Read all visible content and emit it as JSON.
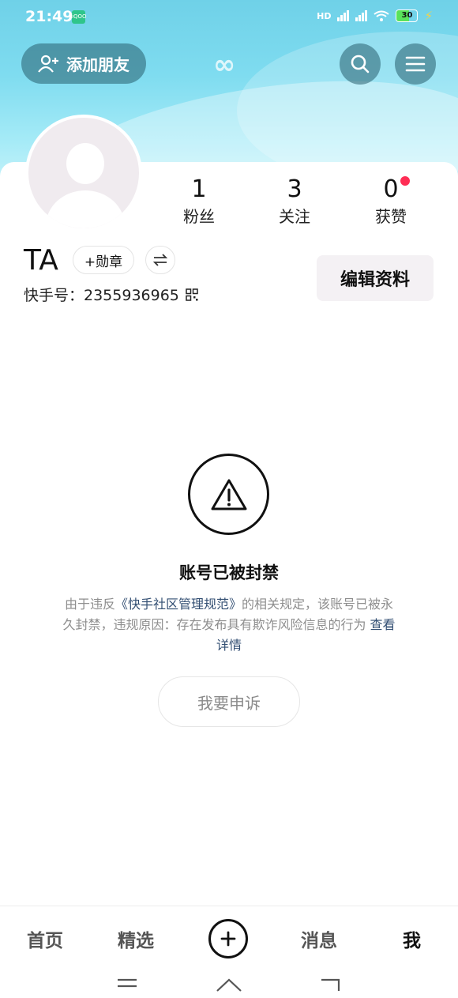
{
  "status_bar": {
    "time": "21:49",
    "app_icon_text": "iQOO",
    "battery": "30"
  },
  "header": {
    "add_friend": "添加朋友",
    "logo": "∞"
  },
  "profile": {
    "stats": [
      {
        "value": "1",
        "label": "粉丝"
      },
      {
        "value": "3",
        "label": "关注"
      },
      {
        "value": "0",
        "label": "获赞"
      }
    ],
    "name": "TA",
    "medal_button": "+勋章",
    "kuaishou_id": "快手号：2355936965",
    "edit_button": "编辑资料"
  },
  "ban": {
    "title": "账号已被封禁",
    "desc_prefix": "由于违反",
    "desc_link": "《快手社区管理规范》",
    "desc_middle": "的相关规定，该账号已被永久封禁，违规原因：存在发布具有欺诈风险信息的行为",
    "detail_link": "查看详情",
    "appeal_button": "我要申诉"
  },
  "tabbar": {
    "home": "首页",
    "featured": "精选",
    "messages": "消息",
    "me": "我"
  },
  "colors": {
    "accent_red": "#ff2d55",
    "link": "#334f73"
  }
}
